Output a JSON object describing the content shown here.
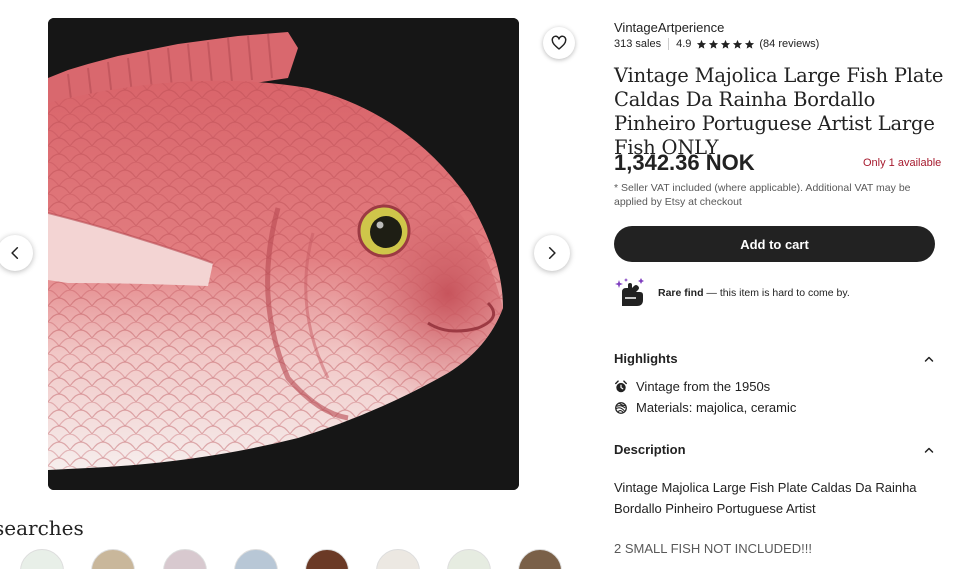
{
  "shop": {
    "name": "VintageArtperience",
    "sales": "313 sales",
    "rating": "4.9",
    "stars": 5,
    "reviews": "(84 reviews)"
  },
  "listing": {
    "title": "Vintage Majolica Large Fish Plate Caldas Da Rainha Bordallo Pinheiro Portuguese Artist Large Fish ONLY",
    "price": "1,342.36 NOK",
    "stock": "Only 1 available",
    "vat_note": "* Seller VAT included (where applicable). Additional VAT may be applied by Etsy at checkout",
    "add_to_cart": "Add to cart",
    "rare_find_bold": "Rare find",
    "rare_find_rest": " — this item is hard to come by."
  },
  "highlights": {
    "label": "Highlights",
    "items": [
      {
        "icon": "alarm-clock-icon",
        "text": "Vintage from the 1950s"
      },
      {
        "icon": "yarn-ball-icon",
        "text": "Materials: majolica, ceramic"
      }
    ]
  },
  "description": {
    "label": "Description",
    "paragraph": "Vintage Majolica Large Fish Plate Caldas Da Rainha Bordallo Pinheiro Portuguese Artist",
    "note": "2 SMALL FISH NOT INCLUDED!!!"
  },
  "related": {
    "title": "searches"
  },
  "colors": {
    "accent_dark": "#222222",
    "stock_red": "#a61a2e",
    "muted": "#595959"
  }
}
